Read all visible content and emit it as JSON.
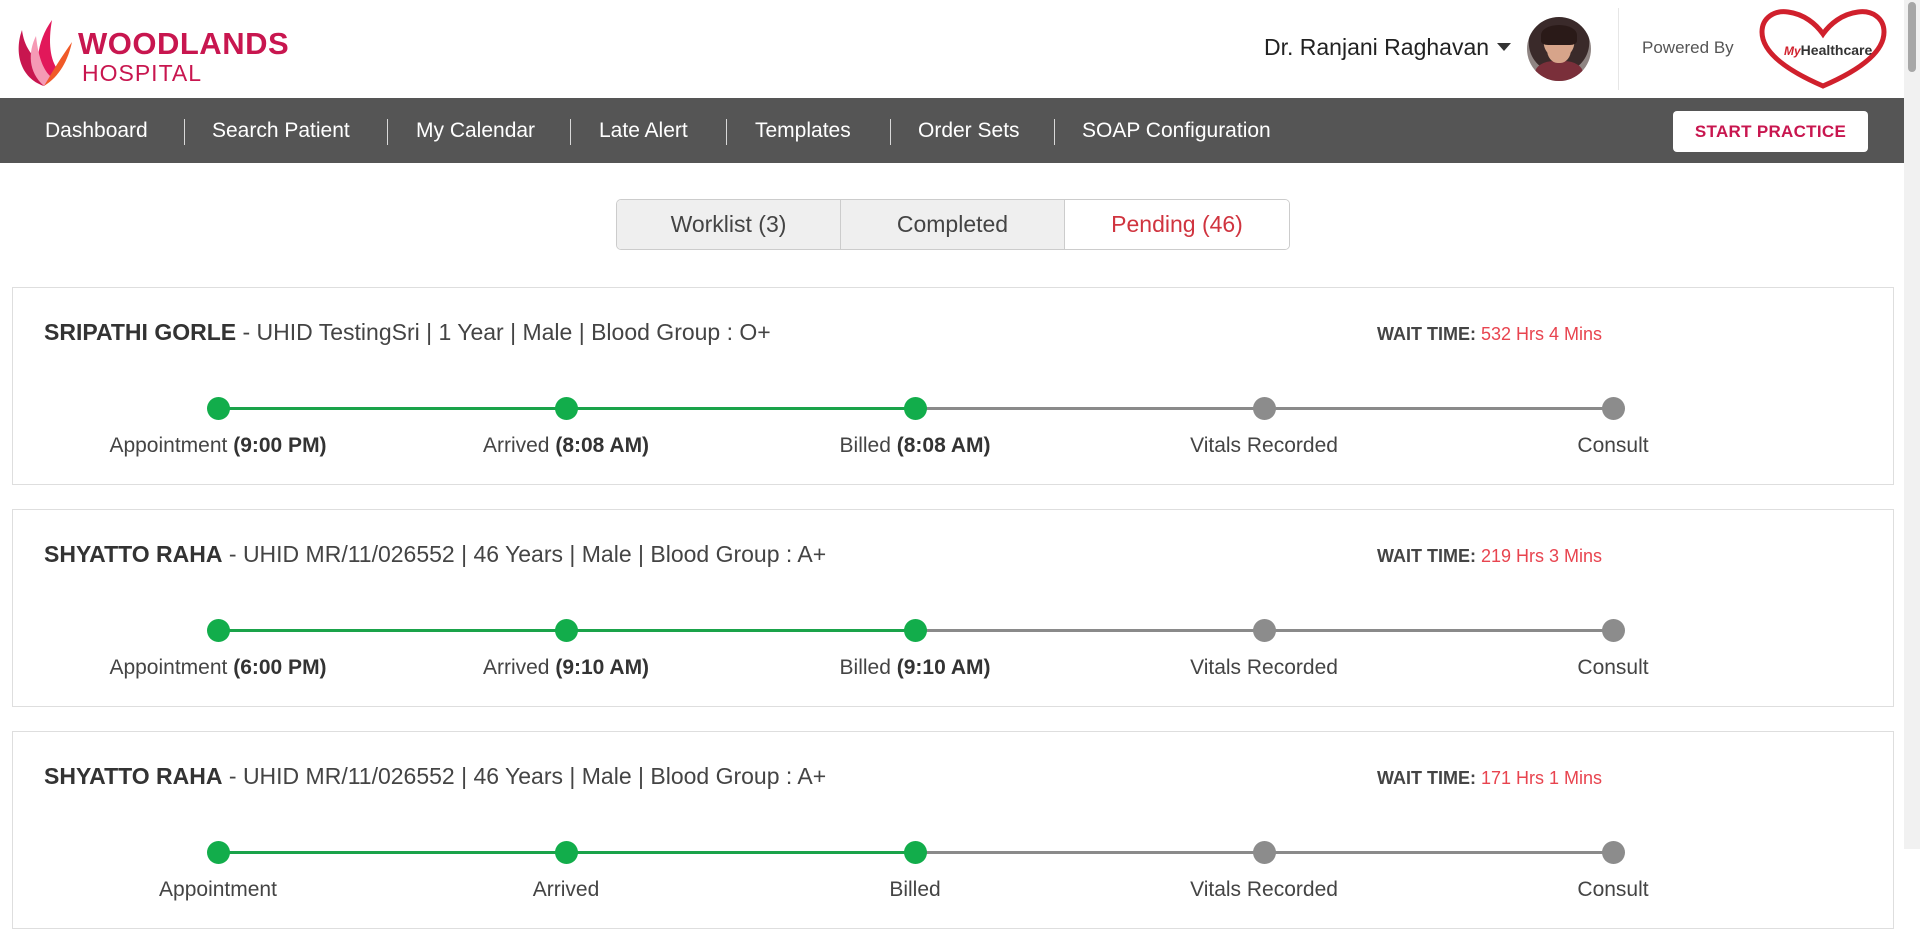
{
  "header": {
    "logo_line1": "WOODLANDS",
    "logo_line2": "HOSPITAL",
    "user_name": "Dr. Ranjani Raghavan",
    "powered_by": "Powered By",
    "partner_logo_prefix": "My",
    "partner_logo_text": "Healthcare"
  },
  "nav": {
    "items": [
      "Dashboard",
      "Search Patient",
      "My Calendar",
      "Late Alert",
      "Templates",
      "Order Sets",
      "SOAP Configuration"
    ],
    "start_button": "START PRACTICE"
  },
  "tabs": [
    {
      "label": "Worklist (3)",
      "active": false
    },
    {
      "label": "Completed",
      "active": false
    },
    {
      "label": "Pending (46)",
      "active": true
    }
  ],
  "wait_label": "WAIT TIME:",
  "patients": [
    {
      "name": "SRIPATHI GORLE",
      "details": " - UHID TestingSri | 1 Year | Male | Blood Group : O+",
      "wait_time": "532 Hrs 4 Mins",
      "steps": [
        {
          "label": "Appointment",
          "time": "(9:00 PM)",
          "done": true
        },
        {
          "label": "Arrived",
          "time": "(8:08 AM)",
          "done": true
        },
        {
          "label": "Billed",
          "time": "(8:08 AM)",
          "done": true
        },
        {
          "label": "Vitals Recorded",
          "time": "",
          "done": false
        },
        {
          "label": "Consult",
          "time": "",
          "done": false
        }
      ]
    },
    {
      "name": "SHYATTO RAHA",
      "details": " - UHID MR/11/026552 | 46 Years | Male | Blood Group : A+",
      "wait_time": "219 Hrs 3 Mins",
      "steps": [
        {
          "label": "Appointment",
          "time": "(6:00 PM)",
          "done": true
        },
        {
          "label": "Arrived",
          "time": "(9:10 AM)",
          "done": true
        },
        {
          "label": "Billed",
          "time": "(9:10 AM)",
          "done": true
        },
        {
          "label": "Vitals Recorded",
          "time": "",
          "done": false
        },
        {
          "label": "Consult",
          "time": "",
          "done": false
        }
      ]
    },
    {
      "name": "SHYATTO RAHA",
      "details": " - UHID MR/11/026552 | 46 Years | Male | Blood Group : A+",
      "wait_time": "171 Hrs 1 Mins",
      "steps": [
        {
          "label": "Appointment",
          "time": "",
          "done": true
        },
        {
          "label": "Arrived",
          "time": "",
          "done": true
        },
        {
          "label": "Billed",
          "time": "",
          "done": true
        },
        {
          "label": "Vitals Recorded",
          "time": "",
          "done": false
        },
        {
          "label": "Consult",
          "time": "",
          "done": false
        }
      ]
    }
  ],
  "colors": {
    "brand": "#c8164f",
    "nav_bg": "#555555",
    "done": "#12ad4b",
    "todo": "#8c8c8c",
    "wait_value": "#e8444f",
    "active_tab": "#d0343f"
  }
}
